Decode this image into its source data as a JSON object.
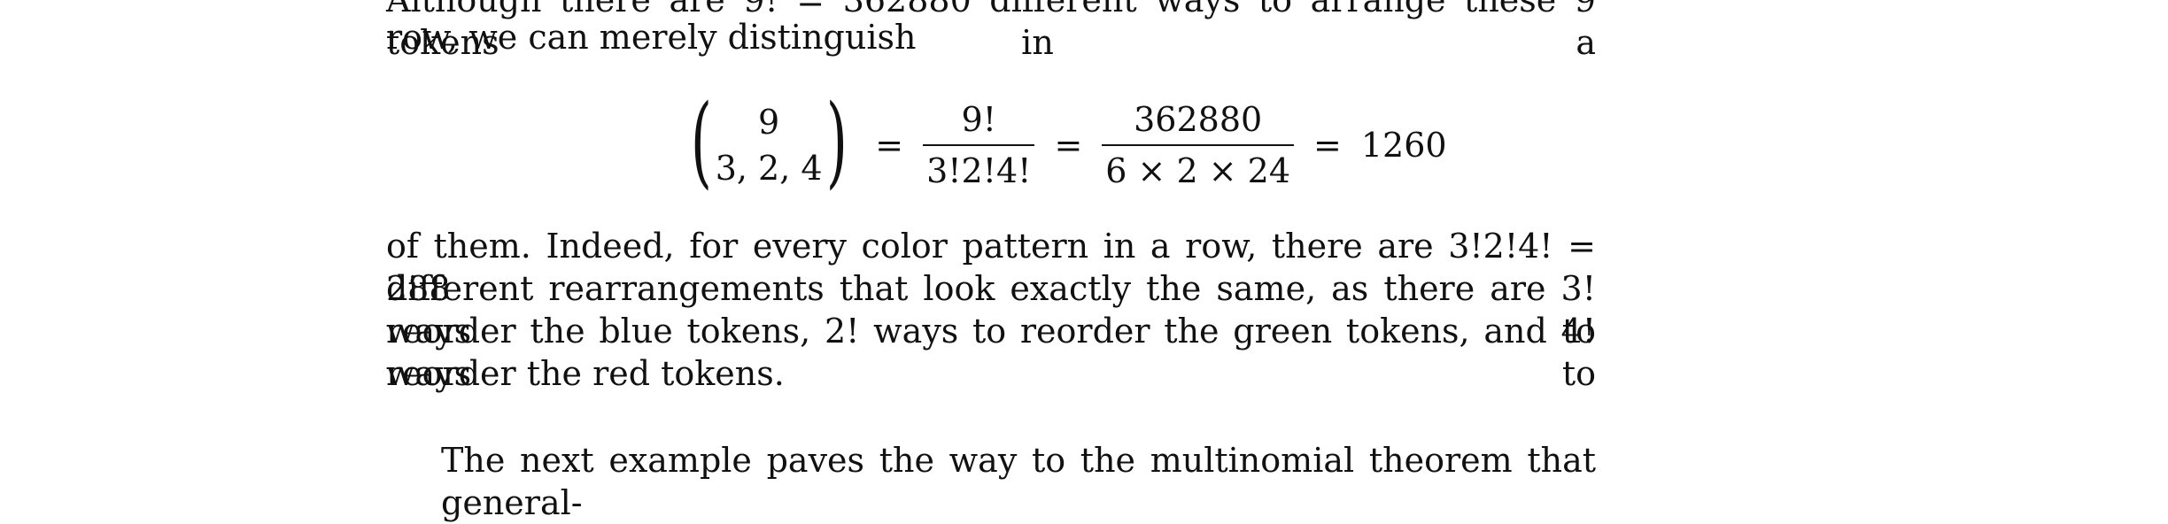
{
  "text": {
    "top_partial": "Although there are 9! = 362880 different ways to arrange these 9 tokens in a",
    "line2": "row, we can merely distinguish",
    "para_lines": [
      "of them.  Indeed, for every color pattern in a row, there are 3!2!4! = 288",
      "different rearrangements that look exactly the same, as there are 3! ways to",
      "reorder the blue tokens, 2! ways to reorder the green tokens, and 4! ways to"
    ],
    "para_last": "reorder the red tokens.",
    "bottom_partial": "The next example paves the way to the multinomial theorem that general-"
  },
  "equation": {
    "binom_top": "9",
    "binom_bottom": "3, 2, 4",
    "eq1": "=",
    "frac1_num": "9!",
    "frac1_den": "3!2!4!",
    "eq2": "=",
    "frac2_num": "362880",
    "frac2_den": "6 × 2 × 24",
    "eq3": "=",
    "result": "1260"
  }
}
